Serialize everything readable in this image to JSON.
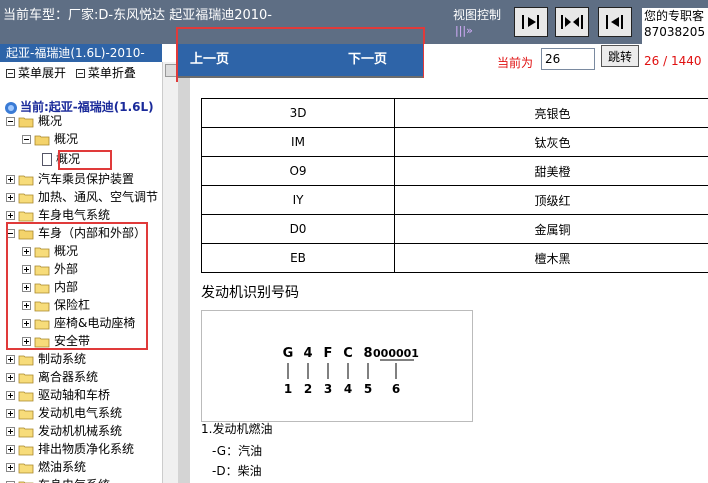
{
  "header": {
    "title": "当前车型：厂家:D-东风悦达 起亚福瑞迪2010-",
    "view_control_label": "视图控制",
    "view_control_sub": "|||»",
    "expert_text_1": "您的专职客",
    "expert_text_2": "87038205"
  },
  "sidebar": {
    "header": "起亚-福瑞迪(1.6L)-2010-",
    "expand_label": "菜单展开",
    "collapse_label": "菜单折叠",
    "tree_title": "当前:起亚-福瑞迪(1.6L)",
    "items": [
      {
        "label": "概况"
      },
      {
        "label": "概况"
      },
      {
        "label": "概况"
      },
      {
        "label": "汽车乘员保护装置"
      },
      {
        "label": "加热、通风、空气调节"
      },
      {
        "label": "车身电气系统"
      },
      {
        "label": "车身（内部和外部）"
      },
      {
        "label": "概况"
      },
      {
        "label": "外部"
      },
      {
        "label": "内部"
      },
      {
        "label": "保险杠"
      },
      {
        "label": "座椅&电动座椅"
      },
      {
        "label": "安全带"
      },
      {
        "label": "制动系统"
      },
      {
        "label": "离合器系统"
      },
      {
        "label": "驱动轴和车桥"
      },
      {
        "label": "发动机电气系统"
      },
      {
        "label": "发动机机械系统"
      },
      {
        "label": "排出物质净化系统"
      },
      {
        "label": "燃油系统"
      },
      {
        "label": "车身电气系统"
      }
    ]
  },
  "nav": {
    "prev_label": "上一页",
    "next_label": "下一页",
    "current_label": "当前为",
    "current_value": "26",
    "jump_label": "跳转",
    "page_count": "26 / 1440"
  },
  "document": {
    "color_rows": [
      {
        "code": "3D",
        "name": "亮银色"
      },
      {
        "code": "IM",
        "name": "钛灰色"
      },
      {
        "code": "O9",
        "name": "甜美橙"
      },
      {
        "code": "IY",
        "name": "顶级红"
      },
      {
        "code": "D0",
        "name": "金属铜"
      },
      {
        "code": "EB",
        "name": "檀木黑"
      }
    ],
    "section_title": "发动机识别号码",
    "vin_chars": [
      "G",
      "4",
      "F",
      "C",
      "8",
      "000001"
    ],
    "vin_index": [
      "1",
      "2",
      "3",
      "4",
      "5",
      "6"
    ],
    "engine_fuel_title": "1.发动机燃油",
    "fuel_g": "-G：汽油",
    "fuel_d": "-D：柴油"
  }
}
